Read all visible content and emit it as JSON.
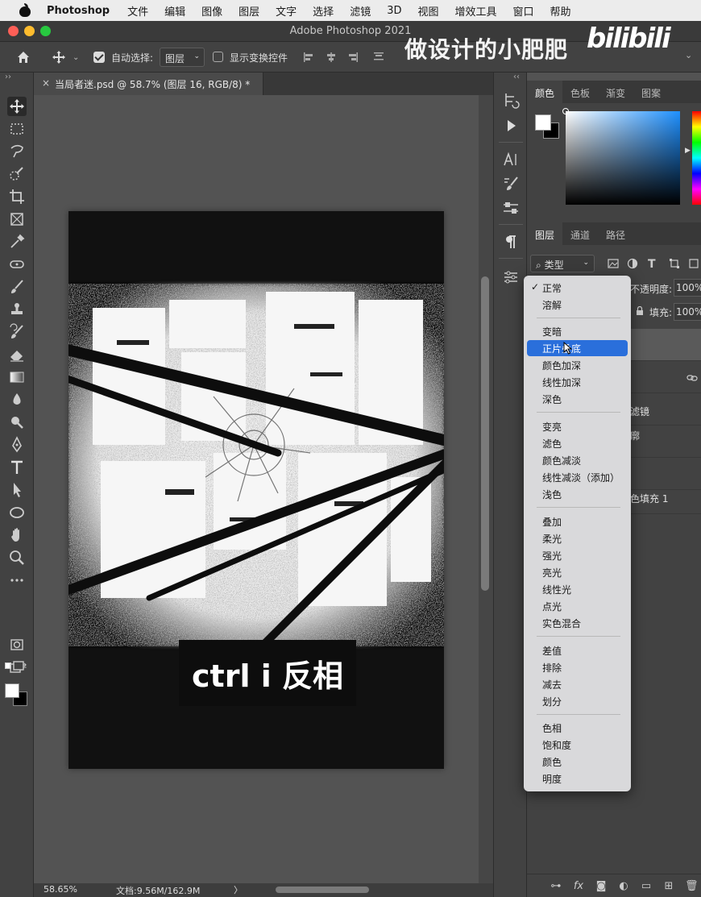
{
  "menubar": {
    "app_name": "Photoshop",
    "items": [
      "文件",
      "编辑",
      "图像",
      "图层",
      "文字",
      "选择",
      "滤镜",
      "3D",
      "视图",
      "增效工具",
      "窗口",
      "帮助"
    ]
  },
  "window": {
    "title": "Adobe Photoshop 2021"
  },
  "options_bar": {
    "auto_select_label": "自动选择:",
    "auto_select_value": "图层",
    "show_transform_label": "显示变换控件"
  },
  "watermark": {
    "text": "做设计的小肥肥",
    "logo": "bilibili"
  },
  "document": {
    "tab_title": "当局者迷.psd @ 58.7% (图层 16, RGB/8) *",
    "caption": "ctrl i 反相"
  },
  "status_bar": {
    "zoom": "58.65%",
    "doc_size": "文档:9.56M/162.9M",
    "arrow": "〉"
  },
  "color_panel": {
    "tabs": [
      "颜色",
      "色板",
      "渐变",
      "图案"
    ],
    "active_tab": "颜色"
  },
  "layers_panel": {
    "tabs": [
      "图层",
      "通道",
      "路径"
    ],
    "filter_label": "类型",
    "opacity_label": "不透明度:",
    "opacity_value": "100%",
    "fill_label": "填充:",
    "fill_value": "100%",
    "partial_rows": [
      "滤镜",
      "廓",
      "色填充 1"
    ]
  },
  "blend_menu": {
    "groups": [
      [
        "正常",
        "溶解"
      ],
      [
        "变暗",
        "正片叠底",
        "颜色加深",
        "线性加深",
        "深色"
      ],
      [
        "变亮",
        "滤色",
        "颜色减淡",
        "线性减淡（添加）",
        "浅色"
      ],
      [
        "叠加",
        "柔光",
        "强光",
        "亮光",
        "线性光",
        "点光",
        "实色混合"
      ],
      [
        "差值",
        "排除",
        "减去",
        "划分"
      ],
      [
        "色相",
        "饱和度",
        "颜色",
        "明度"
      ]
    ],
    "checked": "正常",
    "highlighted": "正片叠底"
  },
  "colors": {
    "accent": "#2a6fdb",
    "ui_dark": "#424242",
    "canvas_bg": "#535353"
  }
}
